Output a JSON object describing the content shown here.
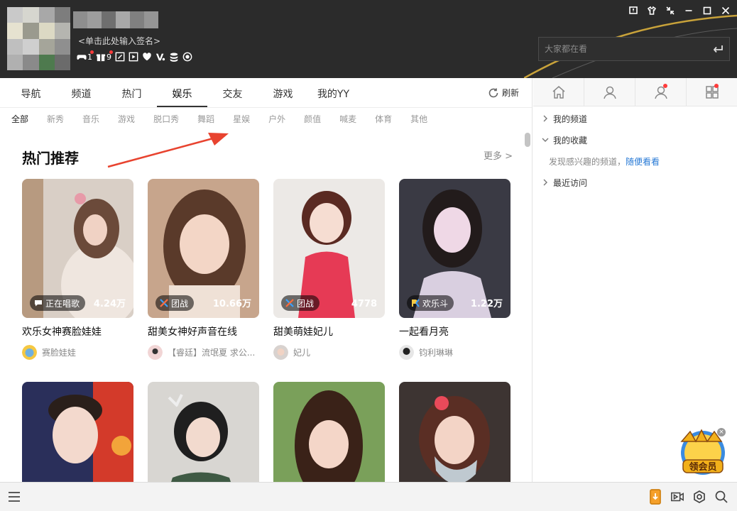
{
  "header": {
    "signature": "<单击此处输入签名>",
    "status": [
      {
        "icon": "gamepad-icon",
        "count": "1"
      },
      {
        "icon": "gift-icon",
        "count": "9"
      },
      {
        "icon": "card-icon",
        "count": ""
      },
      {
        "icon": "play-icon",
        "count": ""
      },
      {
        "icon": "heart-icon",
        "count": ""
      },
      {
        "icon": "v-badge-icon",
        "count": ""
      },
      {
        "icon": "coins-icon",
        "count": ""
      },
      {
        "icon": "eye-icon",
        "count": ""
      }
    ],
    "search_placeholder": "大家都在看"
  },
  "tabs": [
    {
      "label": "导航"
    },
    {
      "label": "频道"
    },
    {
      "label": "热门"
    },
    {
      "label": "娱乐",
      "active": true
    },
    {
      "label": "交友"
    },
    {
      "label": "游戏"
    },
    {
      "label": "我的YY"
    }
  ],
  "refresh_label": "刷新",
  "subtabs": [
    "全部",
    "新秀",
    "音乐",
    "游戏",
    "脱口秀",
    "舞蹈",
    "星娱",
    "户外",
    "颜值",
    "喊麦",
    "体育",
    "其他"
  ],
  "section": {
    "title": "热门推荐",
    "more": "更多 >"
  },
  "cards": [
    {
      "tag": "正在唱歌",
      "tag_icon": "chat-bubble-icon",
      "viewers": "4.24万",
      "title": "欢乐女神赛脸娃娃",
      "anchor": "赛脸娃娃"
    },
    {
      "tag": "团战",
      "tag_icon": "crossed-swords-icon",
      "viewers": "10.66万",
      "title": "甜美女神好声音在线",
      "anchor": "【睿廷】流氓夏 求公..."
    },
    {
      "tag": "团战",
      "tag_icon": "crossed-swords-icon",
      "viewers": "4778",
      "title": "甜美萌娃妃儿",
      "anchor": "妃儿"
    },
    {
      "tag": "欢乐斗",
      "tag_icon": "pk-icon",
      "viewers": "1.22万",
      "title": "一起看月亮",
      "anchor": "钧利琳琳"
    },
    {
      "tag": "",
      "viewers": "",
      "title": "",
      "anchor": ""
    },
    {
      "tag": "",
      "viewers": "",
      "title": "",
      "anchor": ""
    },
    {
      "tag": "",
      "viewers": "",
      "title": "",
      "anchor": ""
    },
    {
      "tag": "",
      "viewers": "",
      "title": "",
      "anchor": ""
    }
  ],
  "right": {
    "items": [
      {
        "label": "我的频道",
        "expanded": false
      },
      {
        "label": "我的收藏",
        "expanded": true
      },
      {
        "label": "最近访问",
        "expanded": false
      }
    ],
    "hint_text": "发现感兴趣的频道，",
    "hint_link": "随便看看",
    "promo_text": "领会员"
  },
  "colors": {
    "header_bg": "#2b2b2b",
    "accent_gold": "#c8a23a",
    "link_blue": "#2a7bd6",
    "notify_red": "#ff3b3b",
    "arrow_red": "#e8432f"
  }
}
